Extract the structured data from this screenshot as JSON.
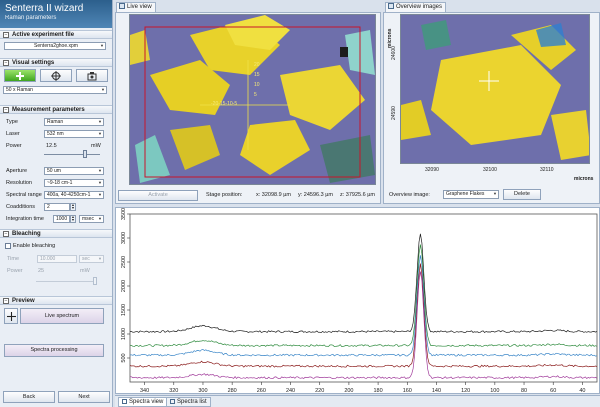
{
  "wizard": {
    "title": "Senterra II wizard",
    "subtitle": "Raman parameters",
    "active_file": {
      "heading": "Active experiment file",
      "value": "Senterra2ghoe.xpm"
    },
    "visual": {
      "heading": "Visual settings",
      "objective": "50 x Raman"
    },
    "measurement": {
      "heading": "Measurement parameters",
      "type_label": "Type",
      "type_value": "Raman",
      "laser_label": "Laser",
      "laser_value": "532 nm",
      "power_label": "Power",
      "power_value": "12.5",
      "power_unit": "mW",
      "aperture_label": "Aperture",
      "aperture_value": "50 um",
      "resolution_label": "Resolution",
      "resolution_value": "~9-18 cm-1",
      "range_label": "Spectral range",
      "range_value": "400a, 40-4250cm-1",
      "coadditions_label": "Coadditions",
      "coadditions_value": "2",
      "integration_label": "Integration time",
      "integration_value": "1000",
      "integration_unit": "msec"
    },
    "bleaching": {
      "heading": "Bleaching",
      "enable_label": "Enable bleaching",
      "time_label": "Time",
      "time_value": "10.000",
      "time_unit": "sec",
      "power_label": "Power",
      "power_value": "25",
      "power_unit": "mW"
    },
    "preview": {
      "heading": "Preview",
      "live_button": "Live spectrum",
      "processing_button": "Spectra processing"
    },
    "nav": {
      "back": "Back",
      "next": "Next"
    }
  },
  "live_view": {
    "tab": "Live view",
    "activate_button": "Activate",
    "stage_label": "Stage position:",
    "stage_x": "x: 32098.9 µm",
    "stage_y": "y: 24596.3 µm",
    "stage_z": "z: 37925.6 µm",
    "scale_ticks": [
      "20",
      "15",
      "10",
      "5"
    ],
    "scale_row": "-20-15-10-5"
  },
  "overview": {
    "tab": "Overview images",
    "y_axis_label": "microns",
    "y_ticks": [
      "24600",
      "24590"
    ],
    "x_ticks": [
      "32090",
      "32100",
      "32110"
    ],
    "x_axis_label": "microns",
    "image_label": "Overview image:",
    "image_value": "Graphene Flakes",
    "delete_button": "Delete"
  },
  "chart_data": {
    "type": "line",
    "title": "",
    "xlabel": "",
    "ylabel": "",
    "x_reversed": true,
    "xlim": [
      30,
      350
    ],
    "ylim": [
      0,
      3500
    ],
    "x_ticks": [
      340,
      320,
      300,
      280,
      260,
      240,
      220,
      200,
      180,
      160,
      140,
      120,
      100,
      80,
      60,
      40
    ],
    "y_ticks": [
      500,
      1000,
      1500,
      2000,
      2500,
      3000,
      3500
    ],
    "grid": false,
    "legend": "none",
    "series": [
      {
        "color": "#1b1b1b",
        "baseline": 1050,
        "peak_x": 151,
        "peak": 3100,
        "hump": 120
      },
      {
        "color": "#2e8b3e",
        "baseline": 760,
        "peak_x": 151,
        "peak": 2850,
        "hump": 110
      },
      {
        "color": "#3a86c8",
        "baseline": 560,
        "peak_x": 151,
        "peak": 2650,
        "hump": 100
      },
      {
        "color": "#8a1a1a",
        "baseline": 330,
        "peak_x": 151,
        "peak": 2450,
        "hump": 90
      },
      {
        "color": "#a03a9a",
        "baseline": 90,
        "peak_x": 151,
        "peak": 2300,
        "hump": 70
      }
    ]
  },
  "bottom_tabs": {
    "spectra_view": "Spectra view",
    "spectra_list": "Spectra list"
  }
}
